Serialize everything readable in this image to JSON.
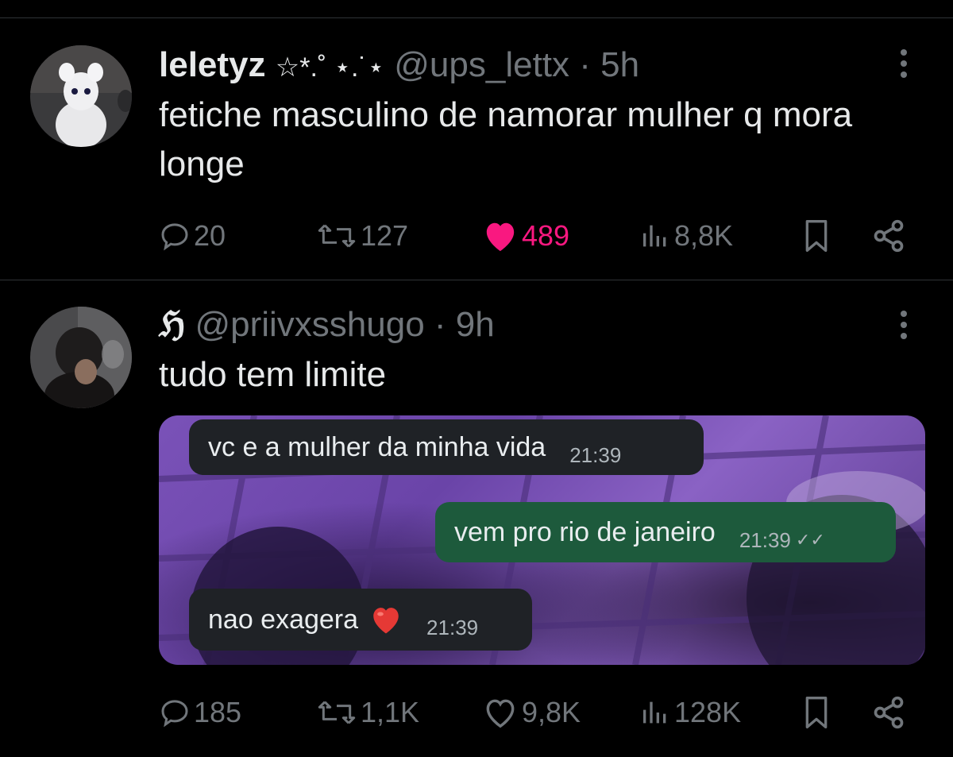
{
  "tweets": [
    {
      "name": "leletyz",
      "name_decoration": "☆*.˚ ⋆.˙⋆",
      "handle": "@ups_lettx",
      "separator": "·",
      "time": "5h",
      "text": "fetiche masculino de namorar mulher q mora longe",
      "stats": {
        "replies": "20",
        "reposts": "127",
        "likes": "489",
        "views": "8,8K"
      },
      "liked": true
    },
    {
      "name": "ℌ",
      "handle": "@priivxsshugo",
      "separator": "·",
      "time": "9h",
      "text": "tudo tem limite",
      "stats": {
        "replies": "185",
        "reposts": "1,1K",
        "likes": "9,8K",
        "views": "128K"
      },
      "liked": false,
      "media": {
        "messages": [
          {
            "direction": "incoming",
            "text": "vc e a mulher da minha vida",
            "time": "21:39"
          },
          {
            "direction": "outgoing",
            "text": "vem pro rio de janeiro",
            "time": "21:39",
            "status": "read"
          },
          {
            "direction": "incoming",
            "text": "nao exagera",
            "emoji": "red-heart",
            "time": "21:39"
          }
        ]
      }
    }
  ],
  "colors": {
    "background": "#000000",
    "text": "#e7e9ea",
    "muted": "#71767b",
    "like": "#f91880",
    "divider": "#2f3336"
  },
  "icons": [
    "reply-icon",
    "repost-icon",
    "like-icon",
    "views-icon",
    "bookmark-icon",
    "share-icon",
    "more-icon"
  ]
}
